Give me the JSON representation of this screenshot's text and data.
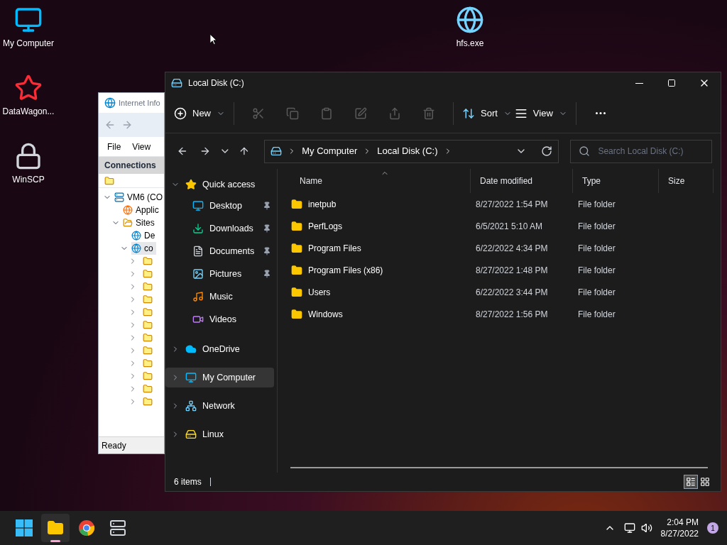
{
  "desktop_icons": [
    {
      "label": "My Computer",
      "kind": "computer"
    },
    {
      "label": "DataWagon...",
      "kind": "star"
    },
    {
      "label": "WinSCP",
      "kind": "lock"
    },
    {
      "label": "hfs.exe",
      "kind": "globe"
    }
  ],
  "iis_window": {
    "title": "Internet Info",
    "menu": [
      "File",
      "View"
    ],
    "panel_title": "Connections",
    "status": "Ready",
    "tree": [
      {
        "label": "VM6 (CO",
        "kind": "server",
        "expanded": true,
        "selected": false,
        "children": [
          {
            "label": "Applic",
            "kind": "pool",
            "selected": false
          },
          {
            "label": "Sites",
            "kind": "sites",
            "expanded": true,
            "selected": false,
            "children": [
              {
                "label": "De",
                "kind": "site",
                "selected": false
              },
              {
                "label": "co",
                "kind": "site",
                "expanded": true,
                "selected": true,
                "children": [
                  {
                    "expanded": false
                  },
                  {
                    "expanded": false
                  },
                  {
                    "expanded": false
                  },
                  {
                    "expanded": false
                  },
                  {
                    "expanded": false
                  },
                  {
                    "expanded": false
                  },
                  {
                    "expanded": false
                  },
                  {
                    "expanded": false
                  },
                  {
                    "expanded": false
                  },
                  {
                    "expanded": false
                  },
                  {
                    "expanded": false
                  },
                  {
                    "expanded": false
                  }
                ]
              }
            ]
          }
        ]
      }
    ]
  },
  "explorer": {
    "title": "Local Disk (C:)",
    "toolbar": [
      {
        "kind": "new",
        "label": "New"
      },
      {
        "kind": "cut",
        "disabled": true
      },
      {
        "kind": "copy",
        "disabled": true
      },
      {
        "kind": "paste",
        "disabled": true
      },
      {
        "kind": "rename",
        "disabled": true
      },
      {
        "kind": "share",
        "disabled": true
      },
      {
        "kind": "delete",
        "disabled": true
      },
      {
        "kind": "sort",
        "label": "Sort"
      },
      {
        "kind": "view",
        "label": "View"
      },
      {
        "kind": "more"
      }
    ],
    "breadcrumb": [
      "My Computer",
      "Local Disk (C:)"
    ],
    "search": {
      "placeholder": "Search Local Disk (C:)"
    },
    "sidebar": [
      {
        "label": "Quick access",
        "kind": "star",
        "expanded": true,
        "selected": false,
        "children": [
          {
            "label": "Desktop",
            "kind": "desktop",
            "pinned": true
          },
          {
            "label": "Downloads",
            "kind": "downloads",
            "pinned": true
          },
          {
            "label": "Documents",
            "kind": "documents",
            "pinned": true
          },
          {
            "label": "Pictures",
            "kind": "pictures",
            "pinned": true
          },
          {
            "label": "Music",
            "kind": "music",
            "pinned": false
          },
          {
            "label": "Videos",
            "kind": "videos",
            "pinned": false
          }
        ]
      },
      {
        "label": "OneDrive",
        "kind": "cloud",
        "expanded": false,
        "selected": false
      },
      {
        "label": "My Computer",
        "kind": "computer",
        "expanded": false,
        "selected": true
      },
      {
        "label": "Network",
        "kind": "network",
        "expanded": false,
        "selected": false
      },
      {
        "label": "Linux",
        "kind": "linux",
        "expanded": false,
        "selected": false
      }
    ],
    "columns": [
      {
        "label": "Name",
        "sorted": true
      },
      {
        "label": "Date modified",
        "sorted": false
      },
      {
        "label": "Type",
        "sorted": false
      },
      {
        "label": "Size",
        "sorted": false
      }
    ],
    "files": [
      {
        "name": "inetpub",
        "date": "8/27/2022 1:54 PM",
        "type": "File folder"
      },
      {
        "name": "PerfLogs",
        "date": "6/5/2021 5:10 AM",
        "type": "File folder"
      },
      {
        "name": "Program Files",
        "date": "6/22/2022 4:34 PM",
        "type": "File folder"
      },
      {
        "name": "Program Files (x86)",
        "date": "8/27/2022 1:48 PM",
        "type": "File folder"
      },
      {
        "name": "Users",
        "date": "6/22/2022 3:44 PM",
        "type": "File folder"
      },
      {
        "name": "Windows",
        "date": "8/27/2022 1:56 PM",
        "type": "File folder"
      }
    ],
    "status": "6 items",
    "views": [
      {
        "kind": "details",
        "selected": true
      },
      {
        "kind": "tiles",
        "selected": false
      }
    ]
  },
  "taskbar": {
    "apps": [
      {
        "kind": "start",
        "selected": false
      },
      {
        "kind": "explorer",
        "selected": true
      },
      {
        "kind": "chrome",
        "selected": false
      },
      {
        "kind": "iis",
        "selected": false
      }
    ],
    "time": "2:04 PM",
    "date": "8/27/2022",
    "notifications": "1"
  }
}
